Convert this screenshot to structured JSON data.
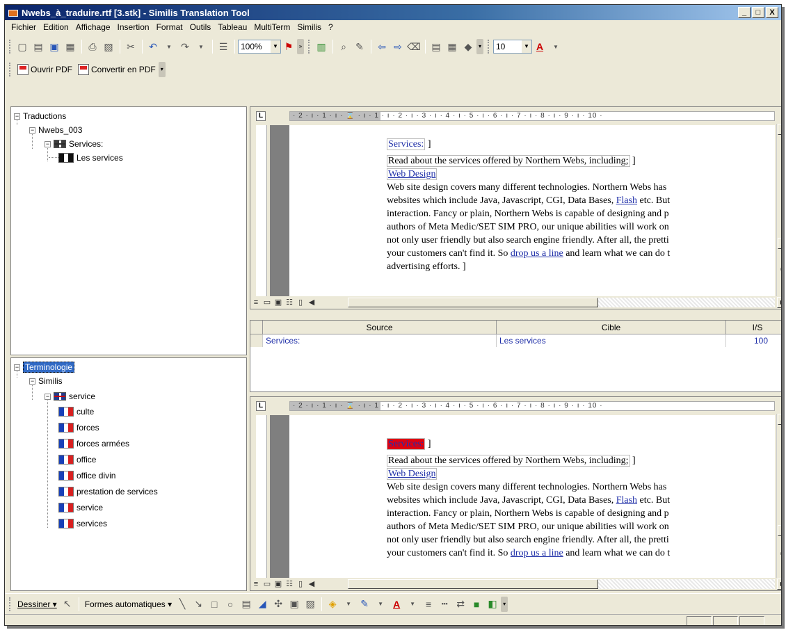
{
  "window": {
    "title": "Nwebs_à_traduire.rtf [3.stk] - Similis Translation Tool",
    "minimize": "_",
    "maximize": "□",
    "close": "X"
  },
  "menu": [
    "Fichier",
    "Edition",
    "Affichage",
    "Insertion",
    "Format",
    "Outils",
    "Tableau",
    "MultiTerm",
    "Similis",
    "?"
  ],
  "toolbar": {
    "zoom": "100%",
    "font_size": "10"
  },
  "pdf_toolbar": {
    "open_pdf": "Ouvrir PDF",
    "convert_pdf": "Convertir en PDF"
  },
  "tree_translations": {
    "root": "Traductions",
    "doc": "Nwebs_003",
    "segment": "Services:",
    "translation": "Les services"
  },
  "tree_terminology": {
    "root": "Terminologie",
    "db": "Similis",
    "term": "service",
    "translations": [
      "culte",
      "forces",
      "forces armées",
      "office",
      "office divin",
      "prestation de services",
      "service",
      "services"
    ]
  },
  "ruler": {
    "marks": "· 2 · ı · 1 · ı · ⌛ · ı · 1 · ı · 2 · ı · 3 · ı · 4 · ı · 5 · ı · 6 · ı · 7 · ı · 8 · ı · 9 · ı · 10 ·"
  },
  "document": {
    "heading": "Services:",
    "intro": "Read about the services offered by Northern Webs, including;",
    "subheading": "Web Design",
    "para": [
      "Web site design covers many different technologies. Northern Webs has",
      "websites which include Java, Javascript, CGI, Data Bases, ",
      " etc. But",
      "interaction. Fancy or plain, Northern Webs is capable of designing and p",
      "authors of Meta Medic/SET SIM PRO, our unique abilities will work on",
      "not only user friendly but also search engine friendly. After all, the pretti",
      "your customers can't find it. So ",
      " and learn what we can do t",
      "advertising efforts."
    ],
    "flash_link": "Flash",
    "drop_link": "drop us a line"
  },
  "match_table": {
    "headers": [
      "Source",
      "Cible",
      "I/S"
    ],
    "rows": [
      {
        "source": "Services:",
        "target": "Les services",
        "score": "100"
      }
    ]
  },
  "draw_toolbar": {
    "draw": "Dessiner ▾",
    "autoshapes": "Formes automatiques ▾"
  },
  "icons": [
    "new-icon",
    "open-icon",
    "save-icon",
    "print-icon",
    "cut-icon",
    "undo-icon",
    "redo-icon",
    "pdf-icon",
    "uk-flag-icon",
    "fr-flag-icon",
    "line-icon",
    "arrow-icon",
    "rect-icon",
    "oval-icon"
  ],
  "colors": {
    "titlebar": "#0A246A",
    "link": "#1F2FA8",
    "highlight": "#E00010"
  }
}
